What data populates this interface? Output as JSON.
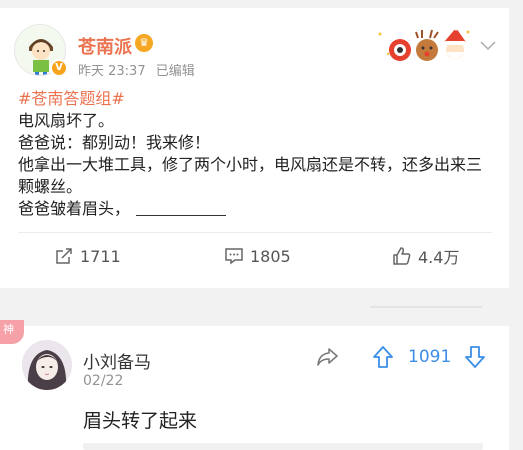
{
  "post": {
    "author": "苍南派",
    "time": "昨天 23:37",
    "edited": "已编辑",
    "hashtag": "#苍南答题组#",
    "lines": [
      "电风扇坏了。",
      "爸爸说：都别动！我来修！",
      "他拿出一大堆工具，修了两个小时，电风扇还是不转，还多出来三颗螺丝。",
      "爸爸皱着眉头，"
    ],
    "actions": {
      "repost_count": "1711",
      "comment_count": "1805",
      "like_count": "4.4万"
    }
  },
  "comment": {
    "badge": "神",
    "name": "小刘备马",
    "date": "02/22",
    "upvotes": "1091",
    "text": "眉头转了起来"
  },
  "colors": {
    "accent_orange": "#eb7350",
    "vote_blue": "#3b8ee8",
    "badge_pink": "#f6a0a8"
  },
  "icons": [
    "crown-icon",
    "chevron-down-icon",
    "repost-icon",
    "comment-icon",
    "like-icon",
    "share-icon",
    "upvote-icon",
    "downvote-icon"
  ]
}
